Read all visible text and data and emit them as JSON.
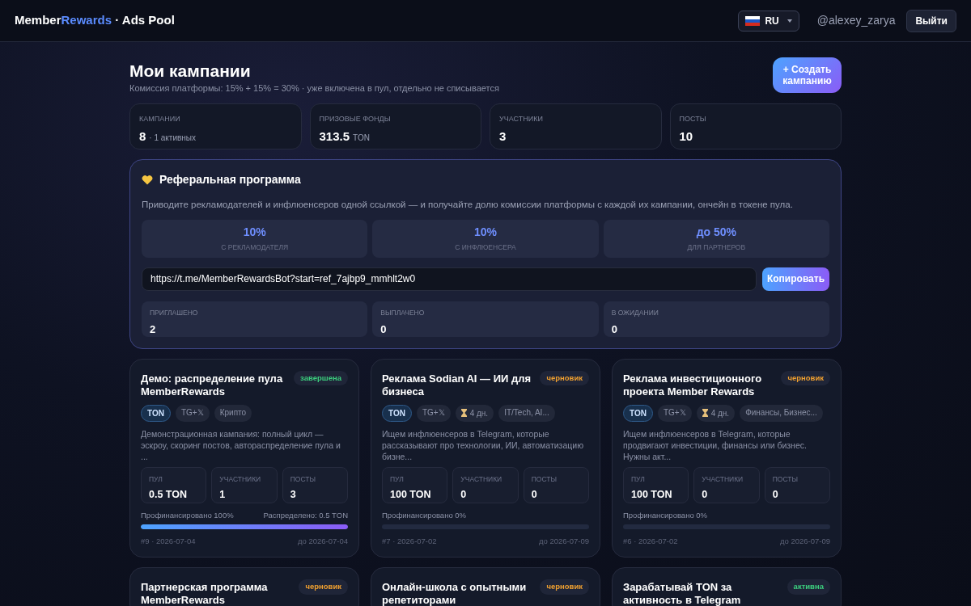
{
  "header": {
    "brand_part_1": "Member",
    "brand_part_2": "Rewards",
    "brand_part_3": " · Ads Pool",
    "language": "RU",
    "username": "@alexey_zarya",
    "logout_button": "Выйти"
  },
  "page": {
    "title": "Мои кампании",
    "subtitle": "Комиссия платформы: 15% + 15% = 30% · уже включена в пул, отдельно не списывается",
    "create_button": "+ Создать кампанию"
  },
  "stats": [
    {
      "label": "КАМПАНИИ",
      "value": "8",
      "note": "· 1 активных"
    },
    {
      "label": "ПРИЗОВЫЕ ФОНДЫ",
      "value": "313.5",
      "note": "TON"
    },
    {
      "label": "УЧАСТНИКИ",
      "value": "3"
    },
    {
      "label": "ПОСТЫ",
      "value": "10"
    }
  ],
  "referral": {
    "title": "Реферальная программа",
    "description": "Приводите рекламодателей и инфлюенсеров одной ссылкой — и получайте долю комиссии платформы с каждой их кампании, ончейн в токене пула.",
    "rates": [
      {
        "value": "10%",
        "label": "С РЕКЛАМОДАТЕЛЯ"
      },
      {
        "value": "10%",
        "label": "С ИНФЛЮЕНСЕРА"
      },
      {
        "value": "до 50%",
        "label": "ДЛЯ ПАРТНЕРОВ"
      }
    ],
    "link": "https://t.me/MemberRewardsBot?start=ref_7ajbp9_mmhlt2w0",
    "copy_button": "Копировать",
    "totals": [
      {
        "label": "ПРИГЛАШЕНО",
        "value": "2"
      },
      {
        "label": "ВЫПЛАЧЕНО",
        "value": "0"
      },
      {
        "label": "В ОЖИДАНИИ",
        "value": "0"
      }
    ]
  },
  "campaigns": [
    {
      "title": "Демо: распределение пула MemberRewards",
      "status": "завершена",
      "color": "#3ccf7e",
      "tags": [
        {
          "kind": "token",
          "text": "TON"
        },
        {
          "kind": "plain",
          "text": "TG+𝕏"
        },
        {
          "kind": "plain",
          "text": "Крипто"
        }
      ],
      "description": "Демонстрационная кампания: полный цикл — эскроу, скоринг постов, автораспределение пула и ...",
      "metrics": [
        {
          "label": "ПУЛ",
          "value": "0.5 TON"
        },
        {
          "label": "УЧАСТНИКИ",
          "value": "1"
        },
        {
          "label": "ПОСТЫ",
          "value": "3"
        }
      ],
      "funded": "Профинансировано 100%",
      "distributed": "Распределено: 0.5 TON",
      "level": 1,
      "id_date": "#9 · 2026-07-04",
      "deadline": "до 2026-07-04"
    },
    {
      "title": "Реклама Sodian AI — ИИ для бизнеса",
      "status": "черновик",
      "color": "#f0a030",
      "tags": [
        {
          "kind": "token",
          "text": "TON"
        },
        {
          "kind": "plain",
          "text": "TG+𝕏"
        },
        {
          "kind": "timer",
          "text": "4 дн."
        },
        {
          "kind": "plain",
          "text": "IT/Tech, AI..."
        }
      ],
      "description": "Ищем инфлюенсеров в Telegram, которые рассказывают про технологии, ИИ, автоматизацию бизне...",
      "metrics": [
        {
          "label": "ПУЛ",
          "value": "100 TON"
        },
        {
          "label": "УЧАСТНИКИ",
          "value": "0"
        },
        {
          "label": "ПОСТЫ",
          "value": "0"
        }
      ],
      "funded": "Профинансировано 0%",
      "level": 0,
      "id_date": "#7 · 2026-07-02",
      "deadline": "до 2026-07-09"
    },
    {
      "title": "Реклама инвестиционного проекта Member Rewards",
      "status": "черновик",
      "color": "#f0a030",
      "tags": [
        {
          "kind": "token",
          "text": "TON"
        },
        {
          "kind": "plain",
          "text": "TG+𝕏"
        },
        {
          "kind": "timer",
          "text": "4 дн."
        },
        {
          "kind": "plain",
          "text": "Финансы, Бизнес..."
        }
      ],
      "description": "Ищем инфлюенсеров в Telegram, которые продвигают инвестиции, финансы или бизнес. Нужны акт...",
      "metrics": [
        {
          "label": "ПУЛ",
          "value": "100 TON"
        },
        {
          "label": "УЧАСТНИКИ",
          "value": "0"
        },
        {
          "label": "ПОСТЫ",
          "value": "0"
        }
      ],
      "funded": "Профинансировано 0%",
      "level": 0,
      "id_date": "#6 · 2026-07-02",
      "deadline": "до 2026-07-09"
    },
    {
      "title": "Партнерская программа MemberRewards",
      "status": "черновик",
      "color": "#f0a030"
    },
    {
      "title": "Онлайн-школа с опытными репетиторами",
      "status": "черновик",
      "color": "#f0a030"
    },
    {
      "title": "Зарабатывай TON за активность в Telegram",
      "status": "активна",
      "color": "#3ccf7e"
    }
  ]
}
